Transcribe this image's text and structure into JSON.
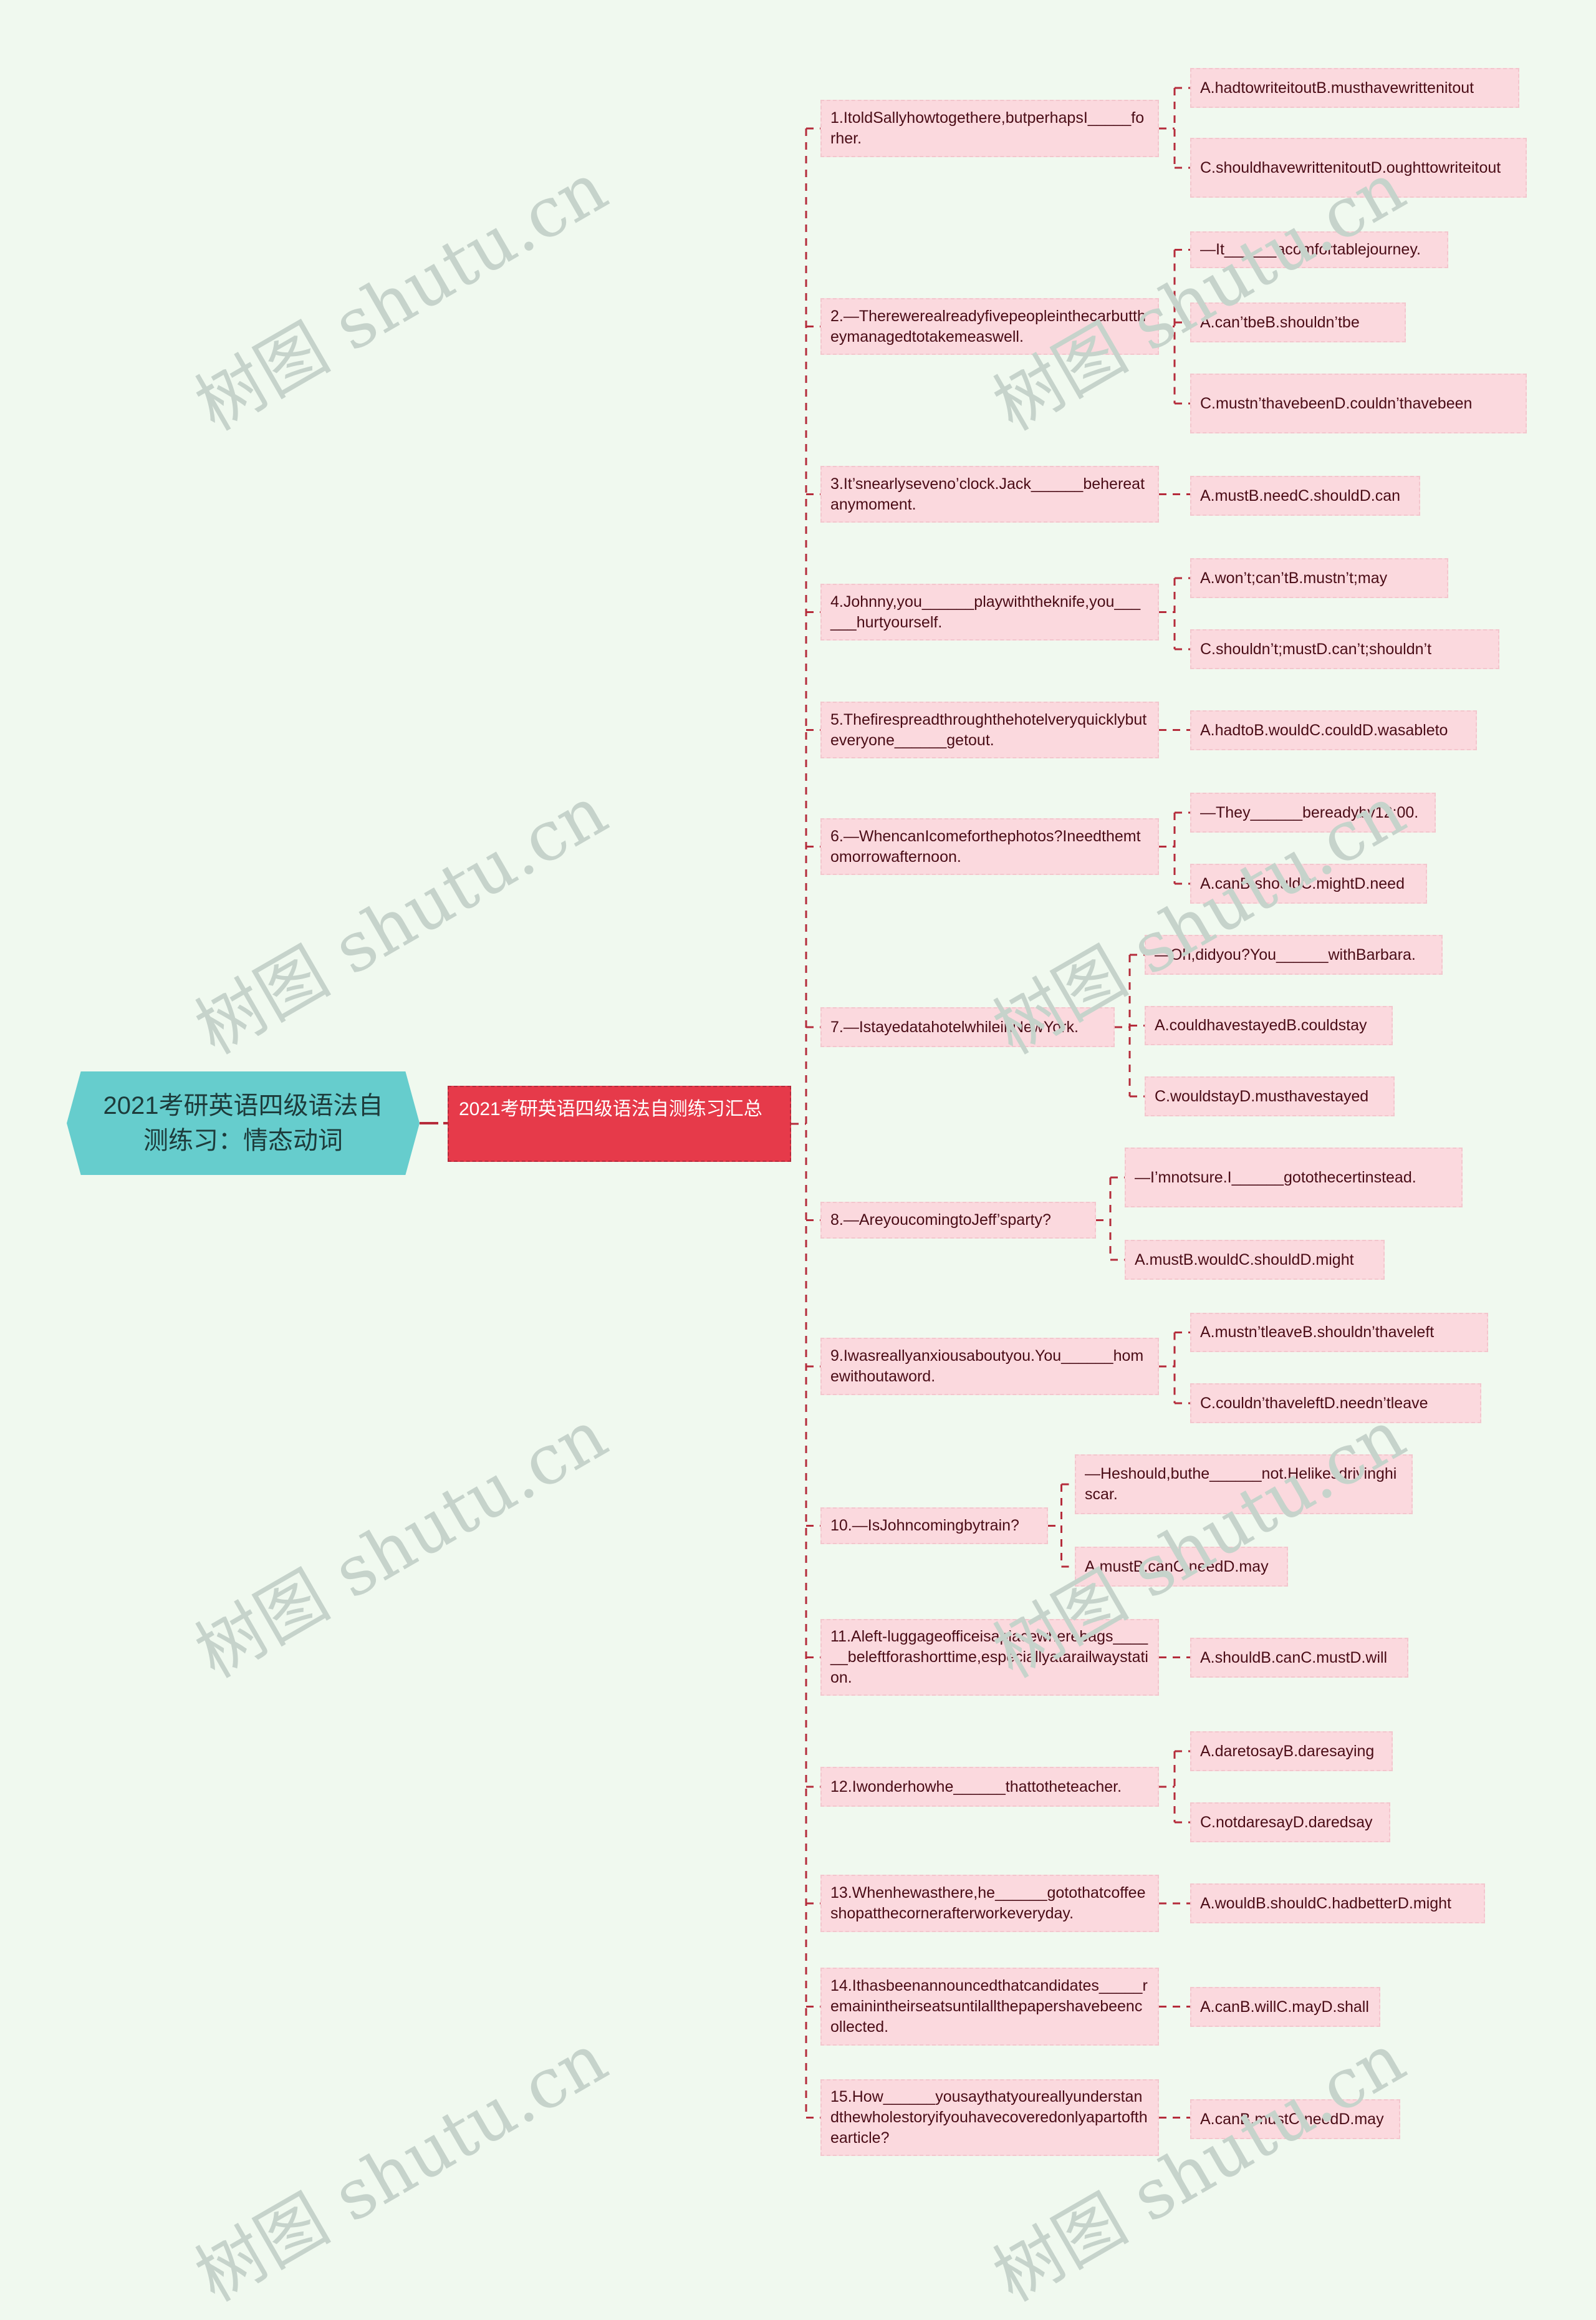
{
  "root": {
    "title": "2021考研英语四级语法自测练习：情态动词"
  },
  "hub": {
    "title": "2021考研英语四级语法自测练习汇总"
  },
  "watermark": "树图 shutu.cn",
  "colors": {
    "background": "#f0f9ef",
    "root": "#66cdcd",
    "hub": "#e63a4a",
    "node": "#fbd9de",
    "connector": "#b52c3b",
    "text": "#4a0c16"
  },
  "questions": [
    {
      "text": "1.ItoldSallyhowtogethere,butperhapsI_____forher.",
      "children": [
        "A.hadtowriteitoutB.musthavewrittenitout",
        "C.shouldhavewrittenitoutD.oughttowriteitout"
      ]
    },
    {
      "text": "2.—Therewerealreadyfivepeopleinthecarbuttheymanagedtotakemeaswell.",
      "children": [
        "—It______acomfortablejourney.",
        "A.can’tbeB.shouldn’tbe",
        "C.mustn’thavebeenD.couldn’thavebeen"
      ]
    },
    {
      "text": "3.It’snearlyseveno’clock.Jack______behereatanymoment.",
      "children": [
        "A.mustB.needC.shouldD.can"
      ]
    },
    {
      "text": "4.Johnny,you______playwiththeknife,you______hurtyourself.",
      "children": [
        "A.won’t;can’tB.mustn’t;may",
        "C.shouldn’t;mustD.can’t;shouldn’t"
      ]
    },
    {
      "text": "5.Thefirespreadthroughthehotelveryquicklybuteveryone______getout.",
      "children": [
        "A.hadtoB.wouldC.couldD.wasableto"
      ]
    },
    {
      "text": "6.—WhencanIcomeforthephotos?Ineedthemtomorrowafternoon.",
      "children": [
        "—They______bereadyby12:00.",
        "A.canB.shouldC.mightD.need"
      ]
    },
    {
      "text": "7.—IstayedatahotelwhileinNewYork.",
      "children": [
        "—Oh,didyou?You______withBarbara.",
        "A.couldhavestayedB.couldstay",
        "C.wouldstayD.musthavestayed"
      ]
    },
    {
      "text": "8.—AreyoucomingtoJeff’sparty?",
      "children": [
        "—I’mnotsure.I______gotothecertinstead.",
        "A.mustB.wouldC.shouldD.might"
      ]
    },
    {
      "text": "9.Iwasreallyanxiousaboutyou.You______homewithoutaword.",
      "children": [
        "A.mustn’tleaveB.shouldn’thaveleft",
        "C.couldn’thaveleftD.needn’tleave"
      ]
    },
    {
      "text": "10.—IsJohncomingbytrain?",
      "children": [
        "—Heshould,buthe______not.Helikesdrivinghiscar.",
        "A.mustB.canC.needD.may"
      ]
    },
    {
      "text": "11.Aleft-luggageofficeisaplacewherebags______beleftforashorttime,especiallyatarailwaystation.",
      "children": [
        "A.shouldB.canC.mustD.will"
      ]
    },
    {
      "text": "12.Iwonderhowhe______thattotheteacher.",
      "children": [
        "A.daretosayB.daresaying",
        "C.notdaresayD.daredsay"
      ]
    },
    {
      "text": "13.Whenhewasthere,he______gotothatcoffeeshopatthecornerafterworkeveryday.",
      "children": [
        "A.wouldB.shouldC.hadbetterD.might"
      ]
    },
    {
      "text": "14.Ithasbeenannouncedthatcandidates_____remainintheirseatsuntilallthepapershavebeencollected.",
      "children": [
        "A.canB.willC.mayD.shall"
      ]
    },
    {
      "text": "15.How______yousaythatyoureallyunderstandthewholestoryifyouhavecoveredonlyapartofthearticle?",
      "children": [
        "A.canB.mustC.needD.may"
      ]
    }
  ]
}
